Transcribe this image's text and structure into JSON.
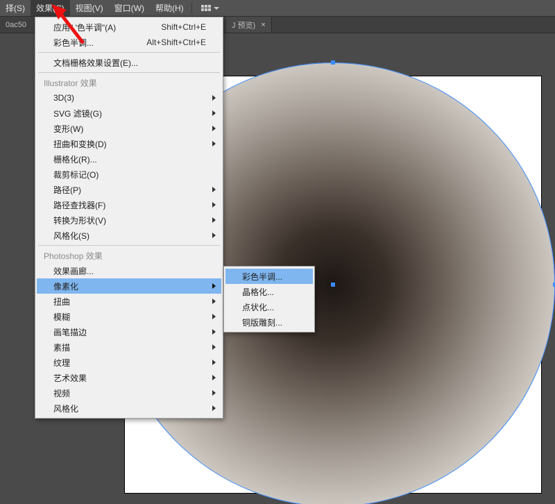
{
  "menubar": {
    "items": [
      {
        "label": "择(S)"
      },
      {
        "label": "效果(C)",
        "active": true
      },
      {
        "label": "视图(V)"
      },
      {
        "label": "窗口(W)"
      },
      {
        "label": "帮助(H)"
      }
    ]
  },
  "tabstrip": {
    "left_label": "0ac50",
    "tab_label": "J 预览)",
    "close_glyph": "×"
  },
  "effects_menu": {
    "apply_last": {
      "label": "应用\"  '色半调\"(A)",
      "shortcut": "Shift+Ctrl+E"
    },
    "color_halftone": {
      "label": "彩色半调...",
      "shortcut": "Alt+Shift+Ctrl+E"
    },
    "doc_raster": "文档栅格效果设置(E)...",
    "header_ai": "Illustrator 效果",
    "ai_items": [
      "3D(3)",
      "SVG 滤镜(G)",
      "变形(W)",
      "扭曲和变换(D)",
      "栅格化(R)...",
      "裁剪标记(O)",
      "路径(P)",
      "路径查找器(F)",
      "转换为形状(V)",
      "风格化(S)"
    ],
    "header_ps": "Photoshop 效果",
    "ps_gallery": "效果画廊...",
    "ps_pixelate": "像素化",
    "ps_items_after": [
      "扭曲",
      "模糊",
      "画笔描边",
      "素描",
      "纹理",
      "艺术效果",
      "视频",
      "风格化"
    ]
  },
  "pixelate_submenu": {
    "items": [
      "彩色半调...",
      "晶格化...",
      "点状化...",
      "铜版雕刻..."
    ]
  },
  "colors": {
    "highlight": "#7fb6ef",
    "selection": "#3b8cff",
    "menubar_bg": "#535353",
    "work_bg": "#4a4a4a"
  }
}
